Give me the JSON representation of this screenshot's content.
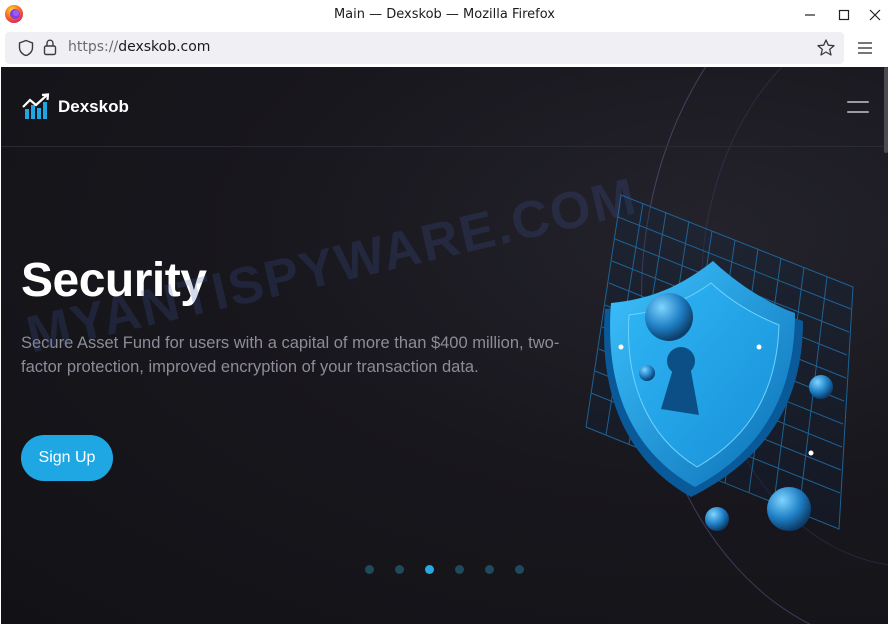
{
  "browser": {
    "window_title": "Main — Dexskob — Mozilla Firefox",
    "url_protocol": "https://",
    "url_host": "dexskob.com"
  },
  "site": {
    "brand_name": "Dexskob",
    "hero_title": "Security",
    "hero_text": "Secure Asset Fund for users with a capital of more than $400 million, two-factor protection, improved encryption of your transaction data.",
    "signup_label": "Sign Up",
    "slides_total": 6,
    "slides_active_index": 2
  },
  "overlay": {
    "watermark_text": "MYANTISPYWARE.COM"
  },
  "colors": {
    "accent": "#1ea7e3",
    "page_bg": "#141418",
    "dot_inactive": "#1f4a5e"
  },
  "icons": [
    "firefox-icon",
    "minimize-icon",
    "maximize-icon",
    "close-icon",
    "shield-icon",
    "lock-icon",
    "star-icon",
    "menu-icon",
    "brand-logo-icon",
    "hamburger-icon"
  ]
}
